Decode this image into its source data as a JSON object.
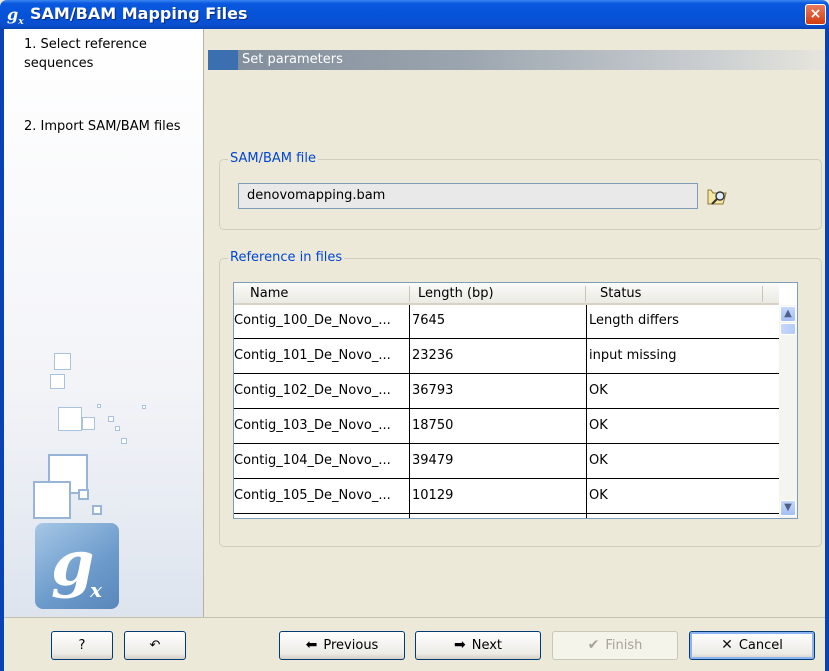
{
  "window": {
    "title": "SAM/BAM Mapping Files",
    "close_glyph": "×"
  },
  "steps": [
    {
      "label": "1.  Select reference sequences"
    },
    {
      "label": "2.  Import SAM/BAM files"
    }
  ],
  "header": {
    "title": "Set parameters"
  },
  "sam_bam_group": {
    "legend": "SAM/BAM file",
    "file_value": "denovomapping.bam",
    "browse_icon": "browse-folder-icon"
  },
  "reference_group": {
    "legend": "Reference in files",
    "columns": [
      "Name",
      "Length (bp)",
      "Status"
    ],
    "rows": [
      {
        "name": "Contig_100_De_Novo_...",
        "length": "7645",
        "status": "Length differs"
      },
      {
        "name": "Contig_101_De_Novo_...",
        "length": "23236",
        "status": "input missing"
      },
      {
        "name": "Contig_102_De_Novo_...",
        "length": "36793",
        "status": "OK"
      },
      {
        "name": "Contig_103_De_Novo_...",
        "length": "18750",
        "status": "OK"
      },
      {
        "name": "Contig_104_De_Novo_...",
        "length": "39479",
        "status": "OK"
      },
      {
        "name": "Contig_105_De_Novo_...",
        "length": "10129",
        "status": "OK"
      }
    ]
  },
  "buttons": {
    "help": "?",
    "reset_glyph": "↶",
    "previous": "Previous",
    "next": "Next",
    "finish": "Finish",
    "cancel": "Cancel"
  },
  "colors": {
    "titlebar": "#0553d8",
    "legend_text": "#0046d5",
    "accent_square": "#3c6fb0"
  }
}
